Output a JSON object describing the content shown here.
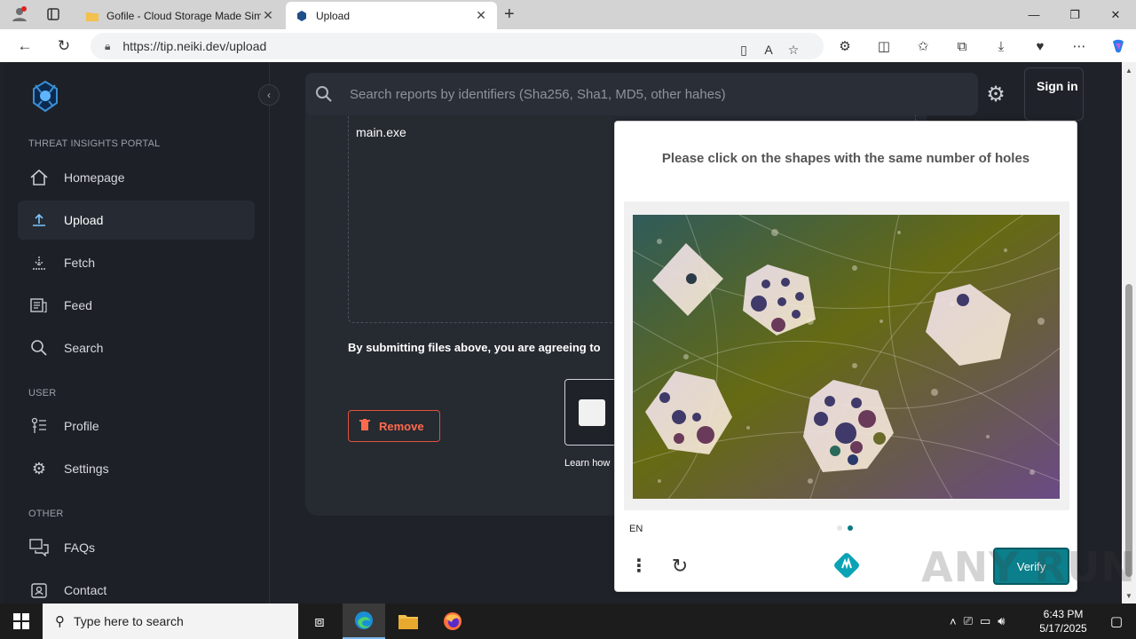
{
  "browser": {
    "tabs": [
      {
        "title": "Gofile - Cloud Storage Made Sim",
        "active": false
      },
      {
        "title": "Upload",
        "active": true
      }
    ],
    "url": "https://tip.neiki.dev/upload"
  },
  "sidebar": {
    "sections": [
      {
        "label": "THREAT INSIGHTS PORTAL"
      },
      {
        "label": "USER"
      },
      {
        "label": "OTHER"
      }
    ],
    "items": [
      {
        "label": "Homepage",
        "icon": "home-icon"
      },
      {
        "label": "Upload",
        "icon": "upload-icon",
        "active": true
      },
      {
        "label": "Fetch",
        "icon": "download-icon"
      },
      {
        "label": "Feed",
        "icon": "feed-icon"
      },
      {
        "label": "Search",
        "icon": "search-icon"
      },
      {
        "label": "Profile",
        "icon": "profile-icon"
      },
      {
        "label": "Settings",
        "icon": "gear-icon"
      },
      {
        "label": "FAQs",
        "icon": "faq-icon"
      },
      {
        "label": "Contact",
        "icon": "contact-icon"
      }
    ]
  },
  "header": {
    "search_placeholder": "Search reports by identifiers (Sha256, Sha1, MD5, other hahes)",
    "signin_label": "Sign in"
  },
  "upload": {
    "filename": "main.exe",
    "agreement_text": "By submitting files above, you are agreeing to",
    "remove_label": "Remove",
    "learn_text": "Learn how"
  },
  "captcha": {
    "prompt": "Please click on the shapes with the same number of holes",
    "language": "EN",
    "page_dots": [
      false,
      true
    ],
    "verify_label": "Verify"
  },
  "watermark": "ANY RUN",
  "taskbar": {
    "search_placeholder": "Type here to search",
    "time": "6:43 PM",
    "date": "5/17/2025"
  },
  "colors": {
    "accent": "#7fc6ff",
    "danger": "#e0533b",
    "captcha_teal": "#0b7f8b",
    "page_bg": "#1f2229"
  }
}
